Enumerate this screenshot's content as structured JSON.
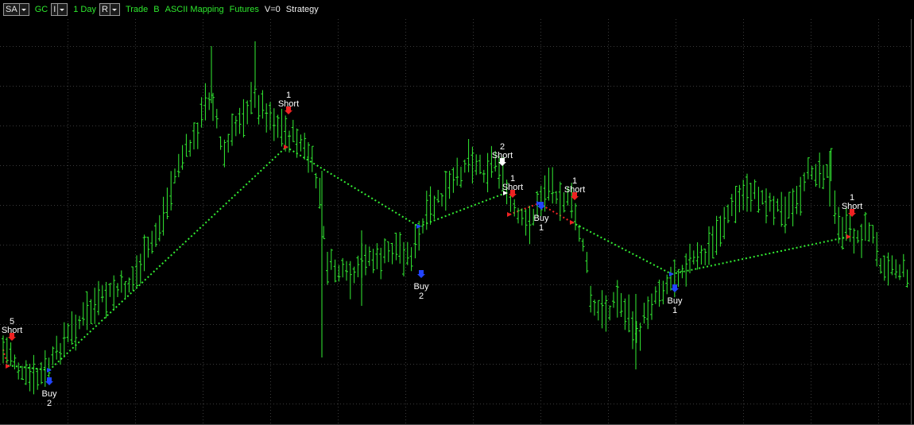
{
  "toolbar": {
    "sa_label": "SA",
    "symbol": "GC",
    "i_label": "I",
    "interval": "1 Day",
    "r_label": "R",
    "trade": "Trade",
    "b_label": "B",
    "ascii_mapping": "ASCII Mapping",
    "futures": "Futures",
    "version": "V=0",
    "strategy": "Strategy"
  },
  "colors": {
    "background": "#000000",
    "bars": "#33ee33",
    "profit_line": "#33ee33",
    "loss_line": "#ee2222",
    "short_arrow": "#ee2222",
    "buy_arrow": "#2244ff",
    "exit_arrow": "#ffffff",
    "label_text": "#ffffff"
  },
  "chart_data": {
    "type": "ohlc",
    "signals": [
      {
        "side": "Short",
        "qty": "5"
      },
      {
        "side": "Buy",
        "qty": "2"
      },
      {
        "side": "Short",
        "qty": "1"
      },
      {
        "side": "Buy",
        "qty": "2"
      },
      {
        "side": "Short",
        "qty": "2"
      },
      {
        "side": "Short",
        "qty": "1"
      },
      {
        "side": "Buy",
        "qty": "1"
      },
      {
        "side": "Short",
        "qty": "1"
      },
      {
        "side": "Buy",
        "qty": "1"
      },
      {
        "side": "Short",
        "qty": "1"
      }
    ]
  }
}
